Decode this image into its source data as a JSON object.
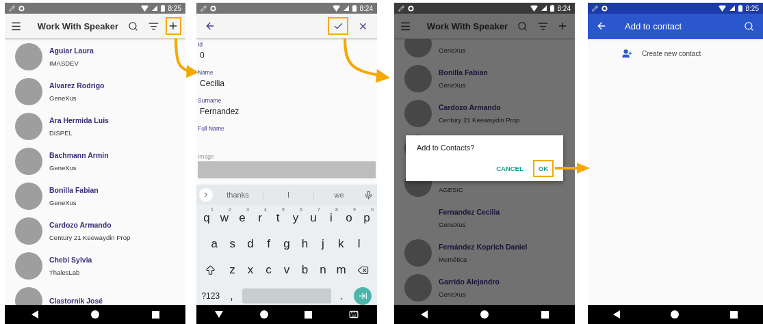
{
  "screens": [
    {
      "kind": "list",
      "time": "8:25",
      "nav": {
        "kind": "menu"
      },
      "title": "Work With Speaker",
      "actions": [
        {
          "kind": "search",
          "highlighted": false
        },
        {
          "kind": "filter",
          "highlighted": false
        },
        {
          "kind": "add",
          "highlighted": true
        }
      ],
      "items": [
        {
          "name": "Aguiar Laura",
          "org": "IMASDEV",
          "photo": true
        },
        {
          "name": "Alvarez Rodrigo",
          "org": "GeneXus",
          "photo": true
        },
        {
          "name": "Ara Hermida Luis",
          "org": "DISPEL",
          "photo": true
        },
        {
          "name": "Bachmann Armin",
          "org": "GeneXus",
          "photo": true
        },
        {
          "name": "Bonilla Fabian",
          "org": "GeneXus",
          "photo": true
        },
        {
          "name": "Cardozo Armando",
          "org": "Century 21 Keewaydin Prop",
          "photo": true
        },
        {
          "name": "Chebi Sylvia",
          "org": "ThalesLab",
          "photo": true
        },
        {
          "name": "Clastornik José",
          "photo": true
        }
      ]
    },
    {
      "kind": "form",
      "time": "8:24",
      "nav": {
        "kind": "back"
      },
      "keyboard_open": true,
      "actions": [
        {
          "kind": "confirm",
          "highlighted": true
        },
        {
          "kind": "close",
          "highlighted": false
        }
      ],
      "fields": [
        {
          "kind": "text",
          "label": "Id",
          "value": "0"
        },
        {
          "kind": "text",
          "label": "Name",
          "value": "Cecilia"
        },
        {
          "kind": "text",
          "label": "Surname",
          "value": "Fernandez"
        },
        {
          "kind": "text",
          "label": "Full Name"
        },
        {
          "kind": "image",
          "label": "Image"
        }
      ],
      "keyboard": {
        "suggestions": [
          "thanks",
          "I",
          "we"
        ],
        "rows": [
          {
            "keys": [
              {
                "kind": "char",
                "label": "q",
                "hint": "1"
              },
              {
                "kind": "char",
                "label": "w",
                "hint": "2"
              },
              {
                "kind": "char",
                "label": "e",
                "hint": "3"
              },
              {
                "kind": "char",
                "label": "r",
                "hint": "4"
              },
              {
                "kind": "char",
                "label": "t",
                "hint": "5"
              },
              {
                "kind": "char",
                "label": "y",
                "hint": "6"
              },
              {
                "kind": "char",
                "label": "u",
                "hint": "7"
              },
              {
                "kind": "char",
                "label": "i",
                "hint": "8"
              },
              {
                "kind": "char",
                "label": "o",
                "hint": "9"
              },
              {
                "kind": "char",
                "label": "p",
                "hint": "0"
              }
            ]
          },
          {
            "keys": [
              {
                "kind": "char",
                "label": "a"
              },
              {
                "kind": "char",
                "label": "s"
              },
              {
                "kind": "char",
                "label": "d"
              },
              {
                "kind": "char",
                "label": "f"
              },
              {
                "kind": "char",
                "label": "g"
              },
              {
                "kind": "char",
                "label": "h"
              },
              {
                "kind": "char",
                "label": "j"
              },
              {
                "kind": "char",
                "label": "k"
              },
              {
                "kind": "char",
                "label": "l"
              }
            ]
          },
          {
            "keys": [
              {
                "kind": "shift"
              },
              {
                "kind": "char",
                "label": "z"
              },
              {
                "kind": "char",
                "label": "x"
              },
              {
                "kind": "char",
                "label": "c"
              },
              {
                "kind": "char",
                "label": "v"
              },
              {
                "kind": "char",
                "label": "b"
              },
              {
                "kind": "char",
                "label": "n"
              },
              {
                "kind": "char",
                "label": "m"
              },
              {
                "kind": "backspace"
              }
            ]
          },
          {
            "keys": [
              {
                "kind": "symbols",
                "label": "?123"
              },
              {
                "kind": "char",
                "label": ","
              },
              {
                "kind": "space"
              },
              {
                "kind": "char",
                "label": "."
              },
              {
                "kind": "enter"
              }
            ]
          }
        ]
      }
    },
    {
      "kind": "list",
      "time": "8:24",
      "nav": {
        "kind": "menu"
      },
      "title": "Work With Speaker",
      "scrolled": true,
      "actions": [
        {
          "kind": "search",
          "highlighted": false
        },
        {
          "kind": "filter",
          "highlighted": false
        },
        {
          "kind": "add",
          "highlighted": false
        }
      ],
      "items": [
        {
          "org": "GeneXus",
          "photo": true
        },
        {
          "name": "Bonilla Fabian",
          "org": "GeneXus",
          "photo": true
        },
        {
          "name": "Cardozo Armando",
          "org": "Century 21 Keewaydin Prop",
          "photo": true
        },
        {
          "photo": true
        },
        {
          "org": "AGESIC",
          "photo": true
        },
        {
          "name": "Fernandez Cecilia",
          "org": "GeneXus",
          "photo": false
        },
        {
          "name": "Fernández Koprich Daniel",
          "org": "Memética",
          "photo": true
        },
        {
          "name": "Garrido Alejandro",
          "org": "GeneXus",
          "photo": true
        }
      ],
      "dialog": {
        "message": "Add to Contacts?",
        "buttons": [
          {
            "label": "CANCEL",
            "highlighted": false
          },
          {
            "label": "OK",
            "highlighted": true
          }
        ]
      }
    },
    {
      "kind": "contacts",
      "time": "8:25",
      "nav": {
        "kind": "back"
      },
      "title": "Add to contact",
      "actions": [
        {
          "kind": "search",
          "highlighted": false
        }
      ],
      "items": [
        {
          "label": "Create new contact"
        }
      ]
    }
  ]
}
